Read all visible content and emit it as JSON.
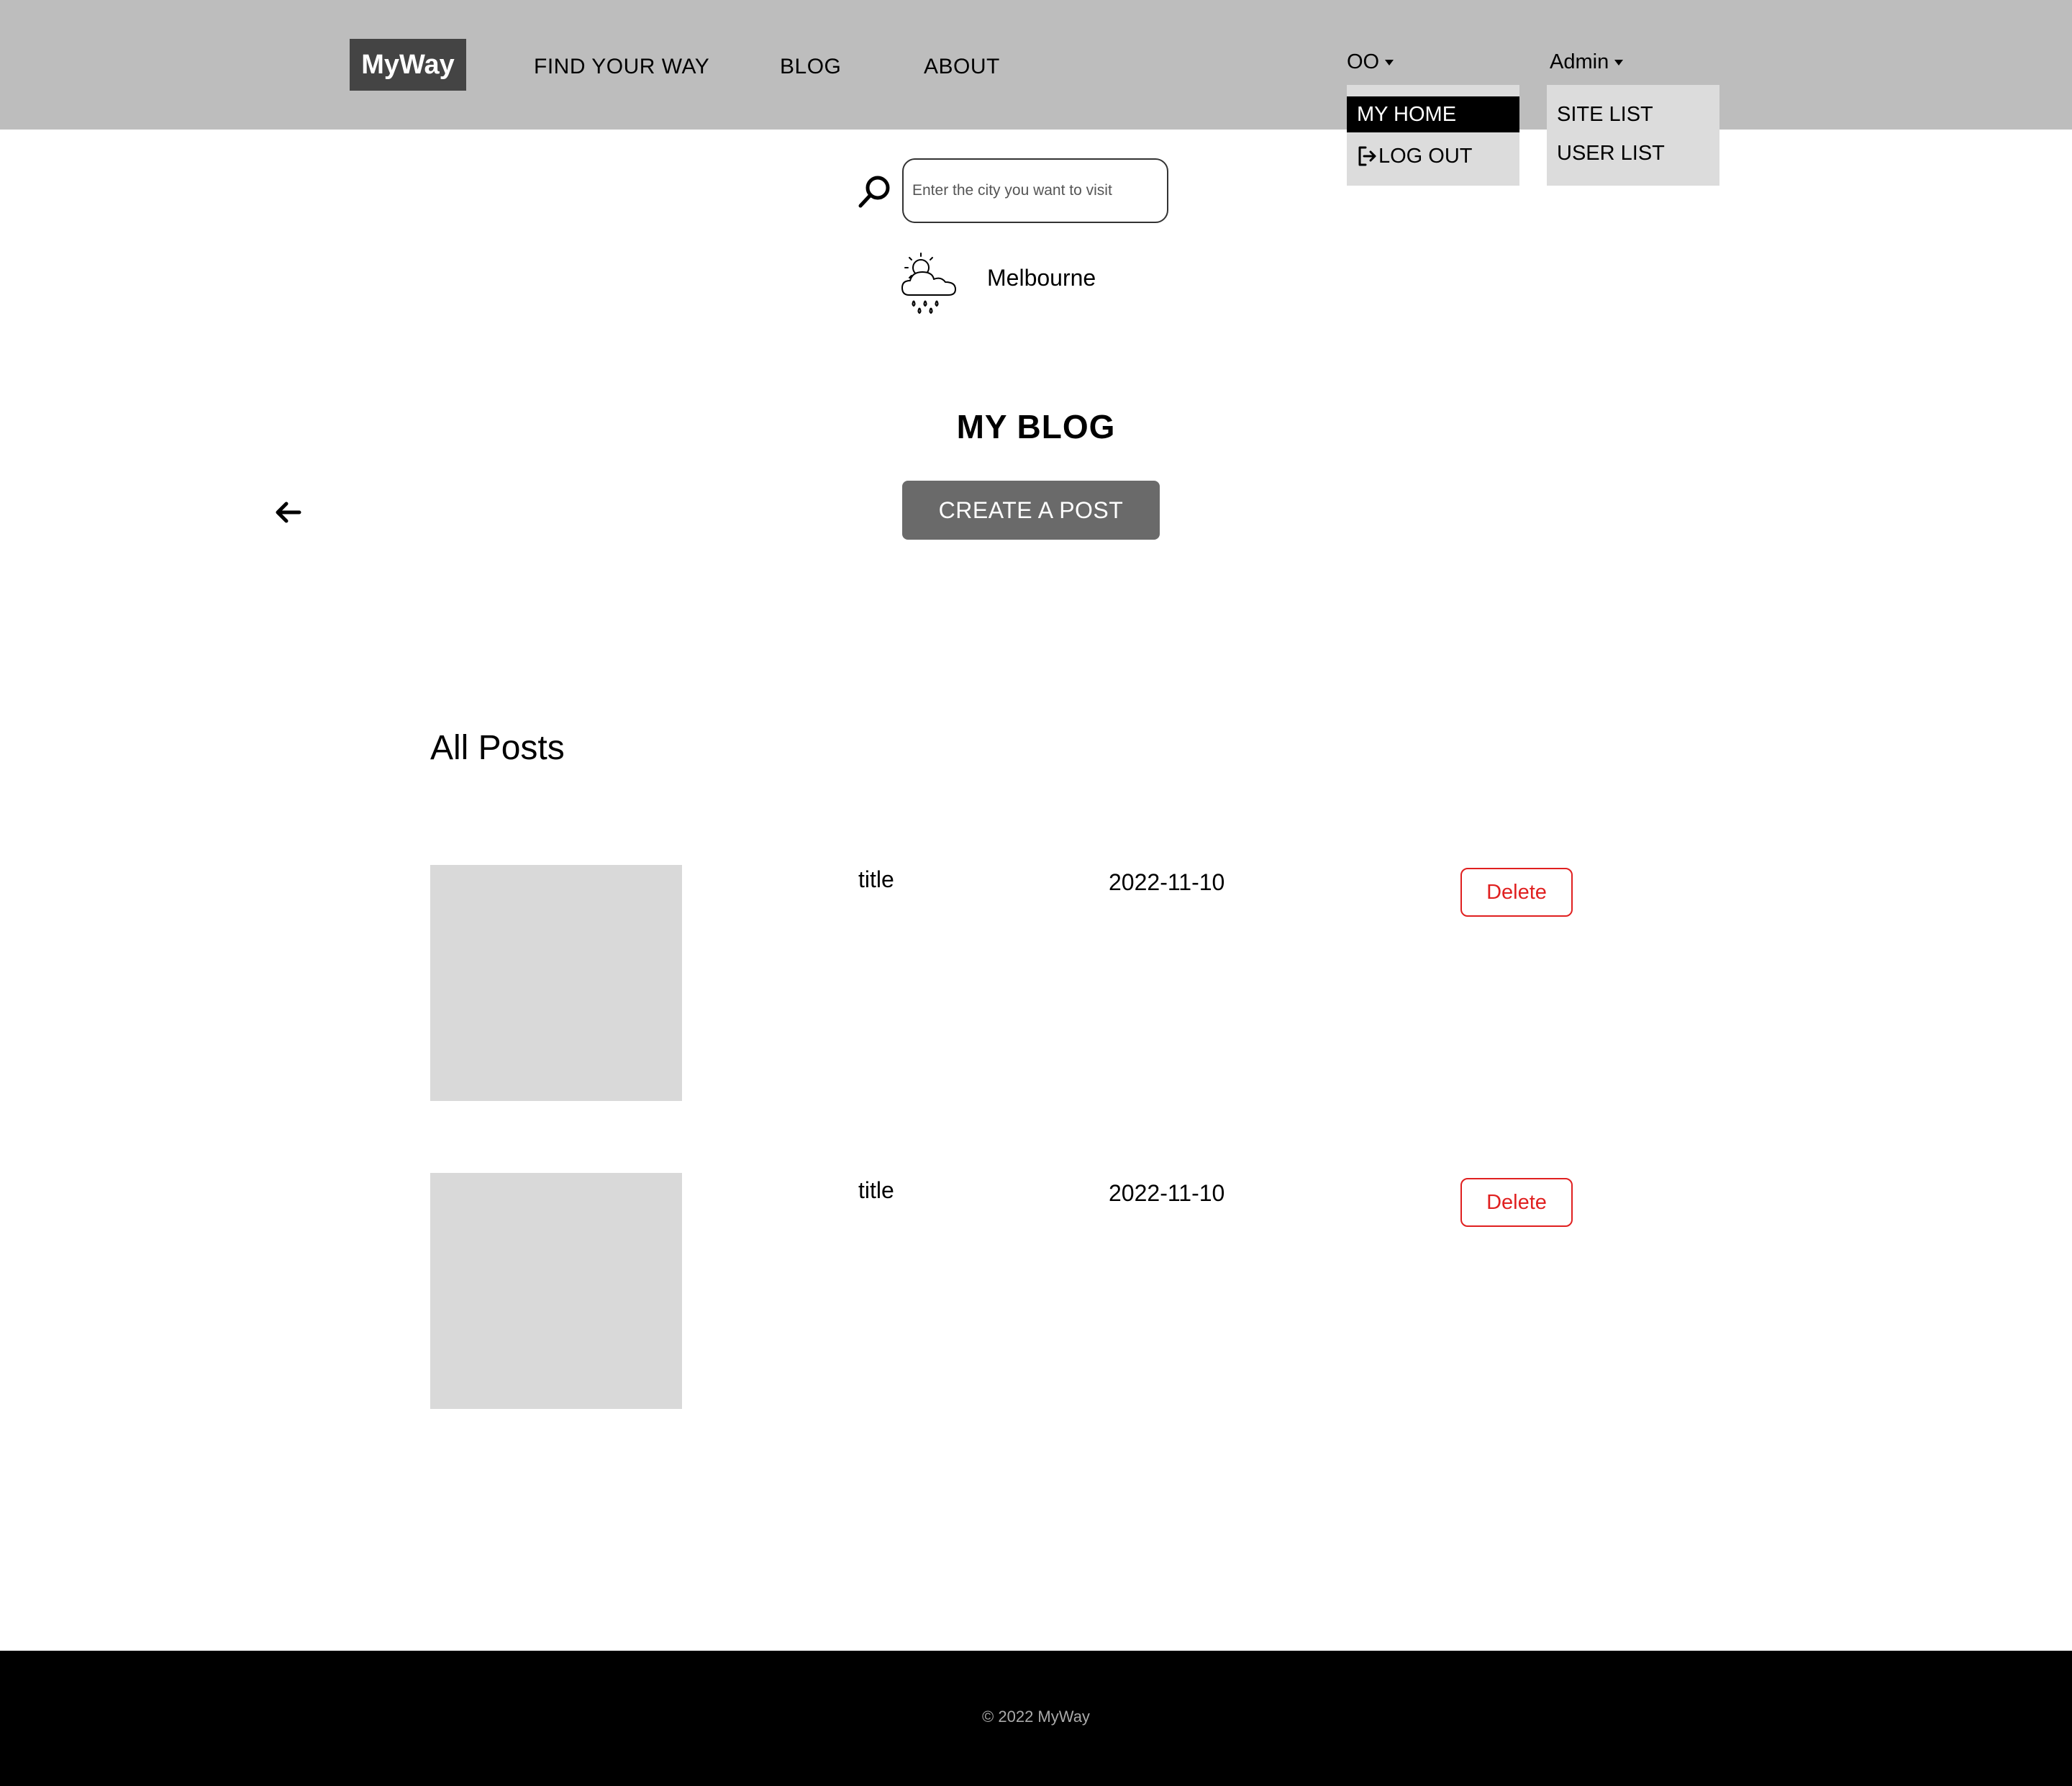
{
  "header": {
    "logo": "MyWay",
    "nav": [
      "FIND YOUR WAY",
      "BLOG",
      "ABOUT"
    ],
    "user_menu": {
      "label": "OO",
      "items": [
        {
          "label": "MY HOME",
          "icon": "",
          "active": true
        },
        {
          "label": "LOG OUT",
          "icon": "logout-icon",
          "active": false
        }
      ]
    },
    "admin_menu": {
      "label": "Admin",
      "items": [
        {
          "label": "SITE LIST"
        },
        {
          "label": "USER LIST"
        }
      ]
    }
  },
  "search": {
    "placeholder": "Enter the city you want to visit",
    "value": "",
    "icon": "search-icon"
  },
  "weather": {
    "icon": "cloud-sun-rain-icon",
    "city": "Melbourne"
  },
  "main": {
    "title": "MY BLOG",
    "back_icon": "arrow-left-icon",
    "create_button": "CREATE A POST",
    "section_title": "All Posts",
    "posts": [
      {
        "title": "title",
        "date": "2022-11-10",
        "action": "Delete"
      },
      {
        "title": "title",
        "date": "2022-11-10",
        "action": "Delete"
      }
    ]
  },
  "footer": {
    "text": "© 2022 MyWay"
  },
  "colors": {
    "header_bg": "#bdbdbd",
    "logo_bg": "#444444",
    "dropdown_bg": "#dcdcdc",
    "button_bg": "#6a6a6a",
    "delete": "#e02020",
    "footer_bg": "#000000"
  }
}
